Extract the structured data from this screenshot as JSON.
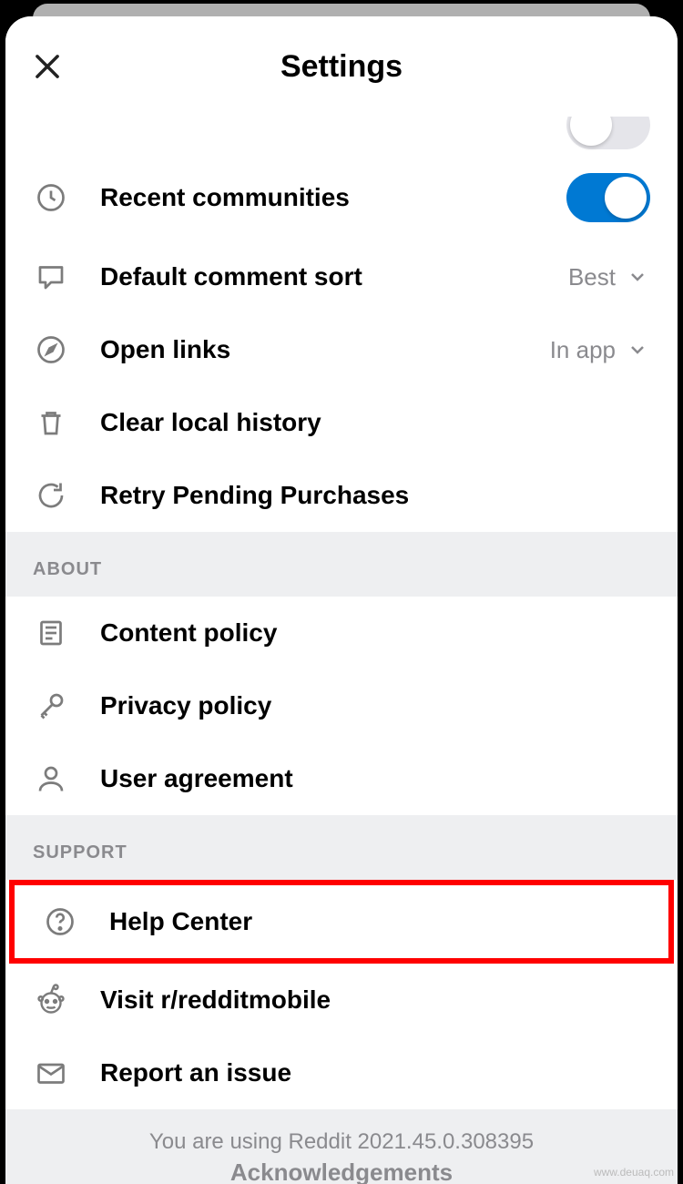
{
  "header": {
    "title": "Settings"
  },
  "rows": {
    "recent_communities": {
      "label": "Recent communities",
      "toggle": true
    },
    "default_comment_sort": {
      "label": "Default comment sort",
      "value": "Best"
    },
    "open_links": {
      "label": "Open links",
      "value": "In app"
    },
    "clear_local_history": {
      "label": "Clear local history"
    },
    "retry_pending_purchases": {
      "label": "Retry Pending Purchases"
    },
    "content_policy": {
      "label": "Content policy"
    },
    "privacy_policy": {
      "label": "Privacy policy"
    },
    "user_agreement": {
      "label": "User agreement"
    },
    "help_center": {
      "label": "Help Center"
    },
    "visit_redditmobile": {
      "label": "Visit r/redditmobile"
    },
    "report_issue": {
      "label": "Report an issue"
    }
  },
  "sections": {
    "about": "ABOUT",
    "support": "SUPPORT"
  },
  "footer": {
    "version_text": "You are using Reddit 2021.45.0.308395",
    "acknowledgements": "Acknowledgements"
  },
  "watermark": "www.deuaq.com"
}
